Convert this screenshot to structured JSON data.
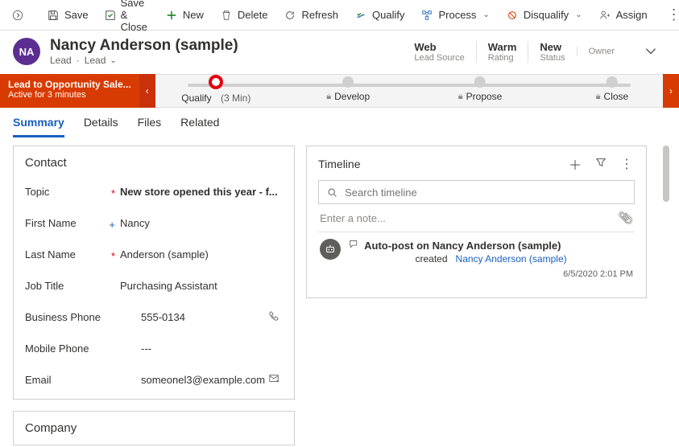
{
  "commands": {
    "save": "Save",
    "save_close": "Save & Close",
    "new": "New",
    "delete": "Delete",
    "refresh": "Refresh",
    "qualify": "Qualify",
    "process": "Process",
    "disqualify": "Disqualify",
    "assign": "Assign"
  },
  "header": {
    "initials": "NA",
    "title": "Nancy Anderson (sample)",
    "entity": "Lead",
    "form": "Lead",
    "stats": [
      {
        "value": "Web",
        "label": "Lead Source"
      },
      {
        "value": "Warm",
        "label": "Rating"
      },
      {
        "value": "New",
        "label": "Status"
      },
      {
        "value": "",
        "label": "Owner"
      }
    ]
  },
  "bpf": {
    "process_name": "Lead to Opportunity Sale...",
    "duration": "Active for 3 minutes",
    "stages": [
      {
        "label": "Qualify",
        "meta": "(3 Min)",
        "active": true,
        "locked": false
      },
      {
        "label": "Develop",
        "meta": "",
        "active": false,
        "locked": true
      },
      {
        "label": "Propose",
        "meta": "",
        "active": false,
        "locked": true
      },
      {
        "label": "Close",
        "meta": "",
        "active": false,
        "locked": true
      }
    ]
  },
  "tabs": {
    "summary": "Summary",
    "details": "Details",
    "files": "Files",
    "related": "Related"
  },
  "contact": {
    "section": "Contact",
    "topic_label": "Topic",
    "topic_value": "New store opened this year - f...",
    "first_name_label": "First Name",
    "first_name_value": "Nancy",
    "last_name_label": "Last Name",
    "last_name_value": "Anderson (sample)",
    "job_title_label": "Job Title",
    "job_title_value": "Purchasing Assistant",
    "business_phone_label": "Business Phone",
    "business_phone_value": "555-0134",
    "mobile_phone_label": "Mobile Phone",
    "mobile_phone_value": "---",
    "email_label": "Email",
    "email_value": "someonel3@example.com"
  },
  "company": {
    "section": "Company"
  },
  "timeline": {
    "title": "Timeline",
    "search_placeholder": "Search timeline",
    "note_placeholder": "Enter a note...",
    "item": {
      "title": "Auto-post on Nancy Anderson (sample)",
      "action": "created",
      "link": "Nancy Anderson (sample)",
      "time": "6/5/2020 2:01 PM"
    }
  }
}
